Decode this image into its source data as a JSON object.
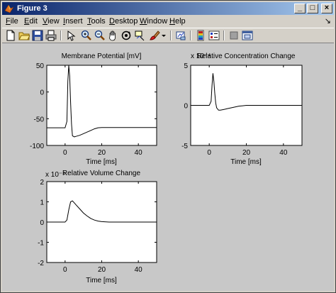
{
  "window": {
    "title": "Figure 3",
    "minimize_glyph": "_",
    "maximize_glyph": "□",
    "close_glyph": "×"
  },
  "menu": {
    "items": [
      {
        "label": "File",
        "accel": "F",
        "rest": "ile"
      },
      {
        "label": "Edit",
        "accel": "E",
        "rest": "dit"
      },
      {
        "label": "View",
        "accel": "V",
        "rest": "iew"
      },
      {
        "label": "Insert",
        "accel": "I",
        "rest": "nsert"
      },
      {
        "label": "Tools",
        "accel": "T",
        "rest": "ools"
      },
      {
        "label": "Desktop",
        "accel": "D",
        "rest": "esktop"
      },
      {
        "label": "Window",
        "accel": "W",
        "rest": "indow"
      },
      {
        "label": "Help",
        "accel": "H",
        "rest": "elp"
      }
    ],
    "dock_arrow": "↘"
  },
  "toolbar": {
    "icons": [
      "new-file-icon",
      "open-folder-icon",
      "save-icon",
      "print-icon",
      "select-arrow-icon",
      "zoom-in-icon",
      "zoom-out-icon",
      "pan-hand-icon",
      "rotate-3d-icon",
      "data-cursor-icon",
      "brush-icon",
      "dropdown-arrow-icon",
      "link-plot-icon",
      "colorbar-icon",
      "legend-icon",
      "hide-plot-tools-icon",
      "show-plot-tools-icon"
    ]
  },
  "chart_data": [
    {
      "type": "line",
      "title": "Membrane Potential [mV]",
      "xlabel": "Time [ms]",
      "ylabel": "",
      "exponent_label": "",
      "xlim": [
        -10,
        50
      ],
      "ylim": [
        -100,
        50
      ],
      "xticks": [
        0,
        20,
        40
      ],
      "yticks": [
        -100,
        -50,
        0,
        50
      ],
      "grid": false,
      "series": [
        {
          "color": "#000000",
          "x": [
            -10,
            0,
            1,
            1.5,
            2,
            2.5,
            3,
            3.5,
            4,
            5,
            6,
            8,
            10,
            12,
            14,
            16,
            18,
            20,
            25,
            30,
            40,
            50
          ],
          "y": [
            -67,
            -67,
            -55,
            20,
            50,
            30,
            -20,
            -60,
            -82,
            -84,
            -83,
            -81,
            -78,
            -75,
            -72,
            -69,
            -67,
            -66.5,
            -66.5,
            -66.5,
            -66.5,
            -66.5
          ]
        }
      ]
    },
    {
      "type": "line",
      "title": "Relative Concentration Change",
      "xlabel": "Time [ms]",
      "ylabel": "",
      "exponent_label": "x 10⁻⁴",
      "xlim": [
        -10,
        50
      ],
      "ylim": [
        -5,
        5
      ],
      "xticks": [
        0,
        20,
        40
      ],
      "yticks": [
        -5,
        0,
        5
      ],
      "grid": false,
      "series": [
        {
          "color": "#000000",
          "x": [
            -10,
            0,
            1,
            1.5,
            2,
            2.5,
            3,
            3.5,
            4,
            5,
            6,
            8,
            10,
            12,
            14,
            16,
            18,
            20,
            30,
            40,
            50
          ],
          "y": [
            0,
            0,
            0.5,
            2.5,
            4,
            3,
            1.5,
            0.3,
            -0.3,
            -0.6,
            -0.6,
            -0.5,
            -0.4,
            -0.3,
            -0.2,
            -0.1,
            -0.05,
            0,
            0,
            0,
            0
          ]
        }
      ]
    },
    {
      "type": "line",
      "title": "Relative Volume Change",
      "xlabel": "Time [ms]",
      "ylabel": "",
      "exponent_label": "x 10⁻⁴",
      "xlim": [
        -10,
        50
      ],
      "ylim": [
        -2,
        2
      ],
      "xticks": [
        0,
        20,
        40
      ],
      "yticks": [
        -2,
        -1,
        0,
        1,
        2
      ],
      "grid": false,
      "series": [
        {
          "color": "#000000",
          "x": [
            -10,
            0,
            1,
            2,
            3,
            4,
            5,
            6,
            8,
            10,
            12,
            14,
            16,
            18,
            20,
            24,
            30,
            40,
            50
          ],
          "y": [
            0,
            0,
            0.1,
            0.6,
            1.0,
            1.05,
            0.95,
            0.85,
            0.65,
            0.45,
            0.3,
            0.18,
            0.1,
            0.05,
            0.02,
            0,
            0,
            0,
            0
          ]
        }
      ]
    }
  ]
}
